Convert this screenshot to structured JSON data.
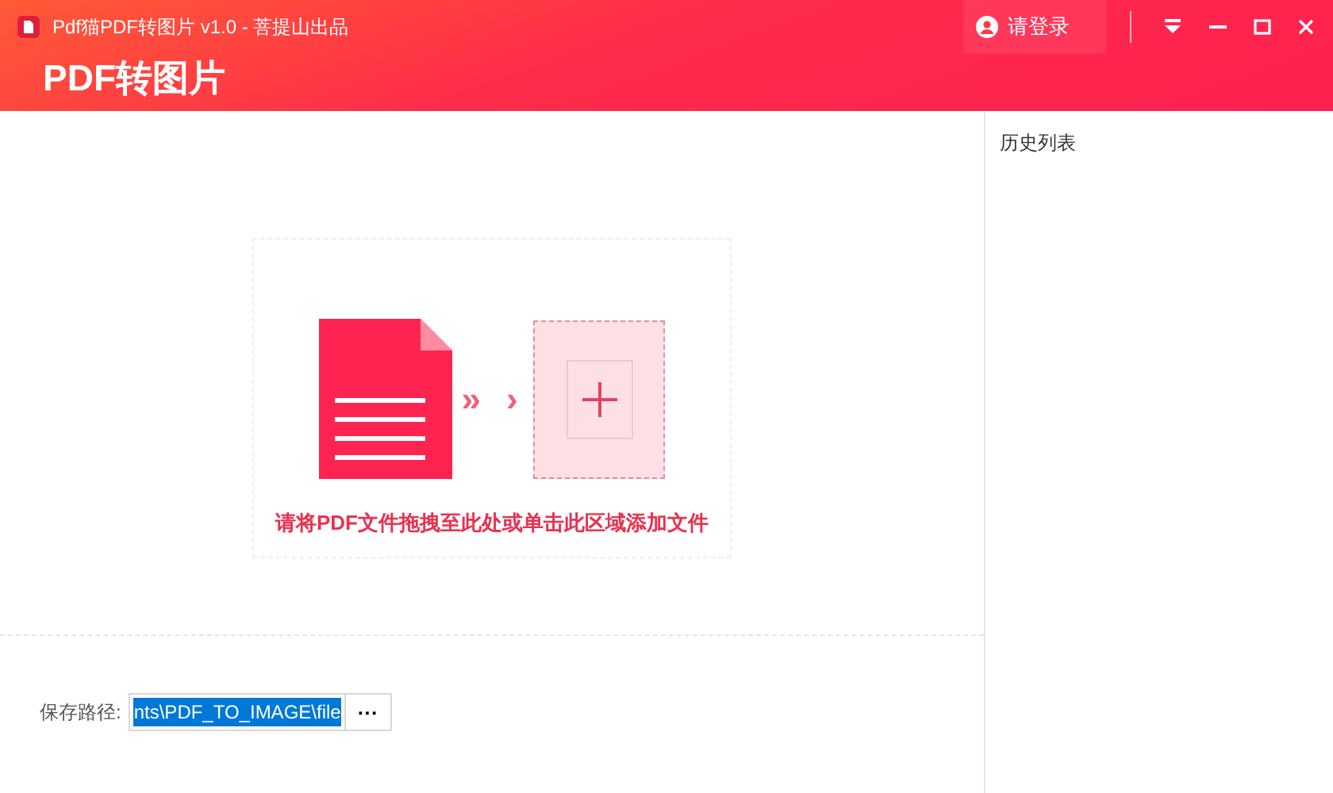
{
  "window": {
    "title": "Pdf猫PDF转图片 v1.0 - 菩提山出品"
  },
  "header": {
    "title": "PDF转图片",
    "login": "请登录"
  },
  "drop_zone": {
    "hint": "请将PDF文件拖拽至此处或单击此区域添加文件",
    "arrows": "»",
    "arrow_single": "›"
  },
  "save_path": {
    "label": "保存路径:",
    "value": "nts\\PDF_TO_IMAGE\\file",
    "text_selected": true,
    "browse": "···"
  },
  "history": {
    "title": "历史列表"
  }
}
